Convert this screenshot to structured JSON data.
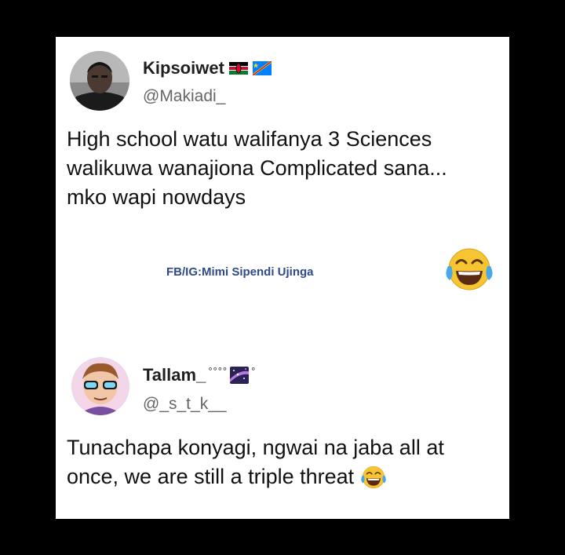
{
  "tweet1": {
    "name": "Kipsoiwet",
    "flags": [
      "kenya-flag-icon",
      "dr-congo-flag-icon"
    ],
    "handle": "@Makiadi_",
    "lines": [
      "High school watu walifanya 3 Sciences",
      "walikuwa wanajiona Complicated sana...",
      "mko wapi nowdays"
    ],
    "watermark": "FB/IG:Mimi Sipendi Ujinga",
    "emoji": "tears-of-joy-emoji-icon"
  },
  "tweet2": {
    "name": "Tallam_",
    "name_decoration": "°°°°",
    "name_decoration_end": "°",
    "handle": "@_s_t_k__",
    "lines": [
      "Tunachapa konyagi, ngwai na jaba all at",
      "once, we are still a triple threat"
    ],
    "emoji": "tears-of-joy-emoji-icon"
  },
  "colors": {
    "background": "#000000",
    "card": "#ffffff",
    "handle": "#666666",
    "watermark": "#2f4a8a",
    "emoji_face": "#f7c531"
  }
}
